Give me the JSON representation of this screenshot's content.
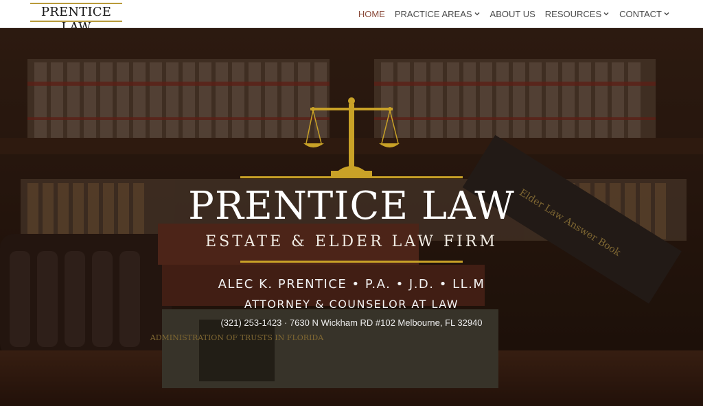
{
  "header": {
    "logo_text": "PRENTICE LAW",
    "nav": [
      {
        "label": "HOME",
        "active": true,
        "has_dropdown": false
      },
      {
        "label": "PRACTICE AREAS",
        "active": false,
        "has_dropdown": true
      },
      {
        "label": "ABOUT US",
        "active": false,
        "has_dropdown": false
      },
      {
        "label": "RESOURCES",
        "active": false,
        "has_dropdown": true
      },
      {
        "label": "CONTACT",
        "active": false,
        "has_dropdown": true
      }
    ]
  },
  "hero": {
    "title": "PRENTICE LAW",
    "subtitle": "ESTATE & ELDER LAW FIRM",
    "attorney_line": "ALEC K. PRENTICE • P.A. • J.D. • LL.M",
    "role_line": "ATTORNEY & COUNSELOR AT LAW",
    "contact_line": "(321) 253-1423 · 7630 N Wickham RD #102 Melbourne, FL 32940",
    "background_book_titles": [
      "ADMINISTRATION OF TRUSTS IN FLORIDA",
      "Elder Law Answer Book"
    ]
  },
  "colors": {
    "gold": "#c9a227",
    "active_nav": "#8a4a3a",
    "nav_text": "#4a4a4a"
  },
  "icons": {
    "scale": "scales-of-justice-icon",
    "dropdown": "chevron-down-icon"
  }
}
